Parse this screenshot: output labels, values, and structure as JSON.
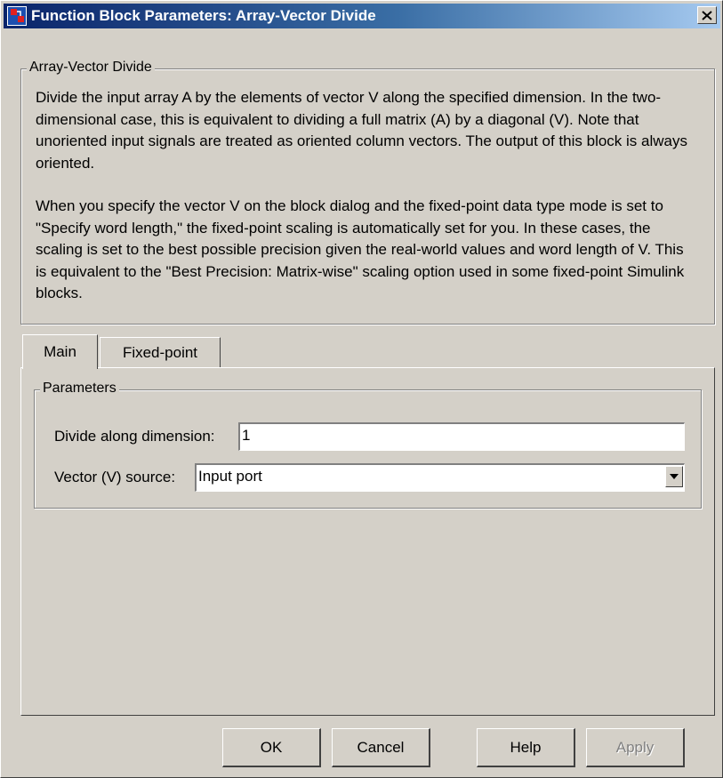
{
  "window": {
    "title": "Function Block Parameters: Array-Vector Divide",
    "close_glyph": "×",
    "titlebar_color": "#0a246a"
  },
  "description": {
    "group_label": "Array-Vector Divide",
    "paragraph1": "Divide the input array A by the elements of vector V along the specified dimension.  In the two-dimensional case, this is equivalent to dividing a full matrix (A) by a diagonal (V). Note that unoriented input signals are treated as oriented column vectors. The output of this block is always oriented.",
    "paragraph2": "When you specify the vector V on the block dialog and the fixed-point data type mode is set to \"Specify word length,\" the fixed-point scaling is automatically set for you. In these cases, the scaling is set to the best possible precision given the real-world values and word length of V. This is equivalent to the \"Best Precision: Matrix-wise\" scaling option used in some fixed-point Simulink blocks."
  },
  "tabs": [
    {
      "label": "Main",
      "active": true
    },
    {
      "label": "Fixed-point",
      "active": false
    }
  ],
  "parameters": {
    "group_label": "Parameters",
    "dimension_label": "Divide along dimension:",
    "dimension_value": "1",
    "source_label": "Vector (V) source:",
    "source_value": "Input port"
  },
  "buttons": {
    "ok": "OK",
    "cancel": "Cancel",
    "help": "Help",
    "apply": "Apply"
  },
  "icons": {
    "app": "simulink-block-icon",
    "close": "close-icon",
    "dropdown": "chevron-down-icon"
  }
}
